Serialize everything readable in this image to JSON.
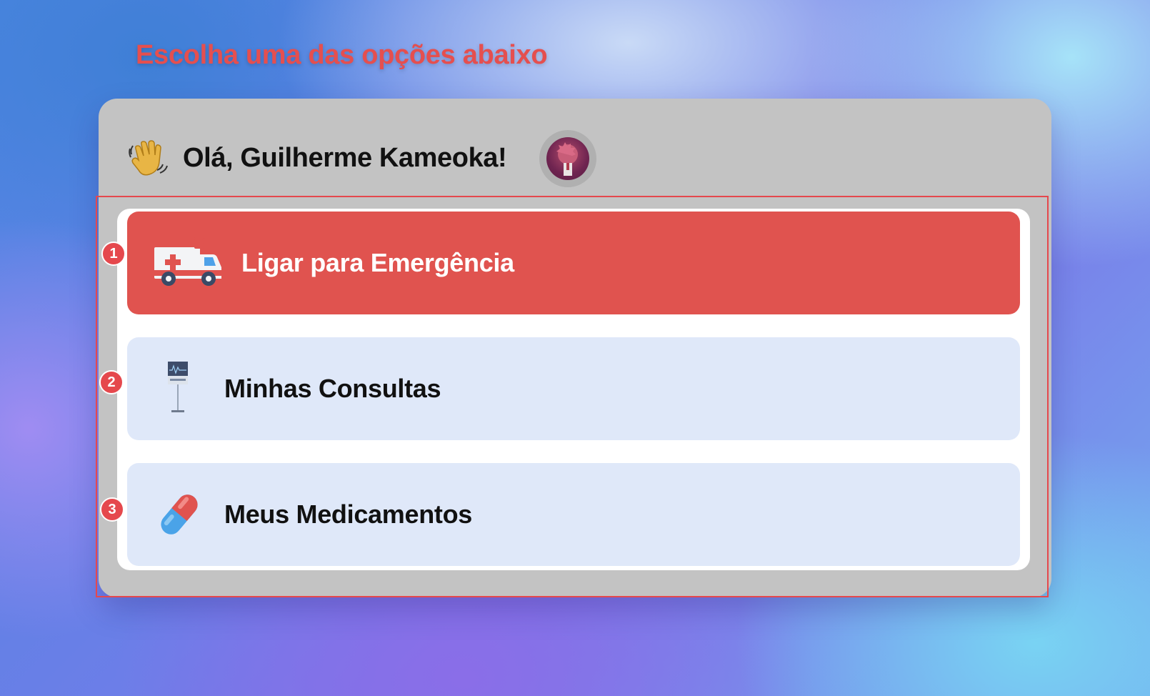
{
  "instruction": "Escolha uma das opções abaixo",
  "header": {
    "greeting": "Olá, Guilherme Kameoka!",
    "wave_icon": "waving-hand-icon",
    "avatar": "user-avatar"
  },
  "options": [
    {
      "badge": "1",
      "label": "Ligar para Emergência",
      "icon": "ambulance-icon",
      "color": "#e0534f"
    },
    {
      "badge": "2",
      "label": "Minhas Consultas",
      "icon": "medical-monitor-icon",
      "color": "#dfe8f9"
    },
    {
      "badge": "3",
      "label": "Meus Medicamentos",
      "icon": "pill-icon",
      "color": "#dfe8f9"
    }
  ],
  "colors": {
    "accent": "#e5484d",
    "card": "#c3c3c3",
    "panel": "#ffffff"
  }
}
